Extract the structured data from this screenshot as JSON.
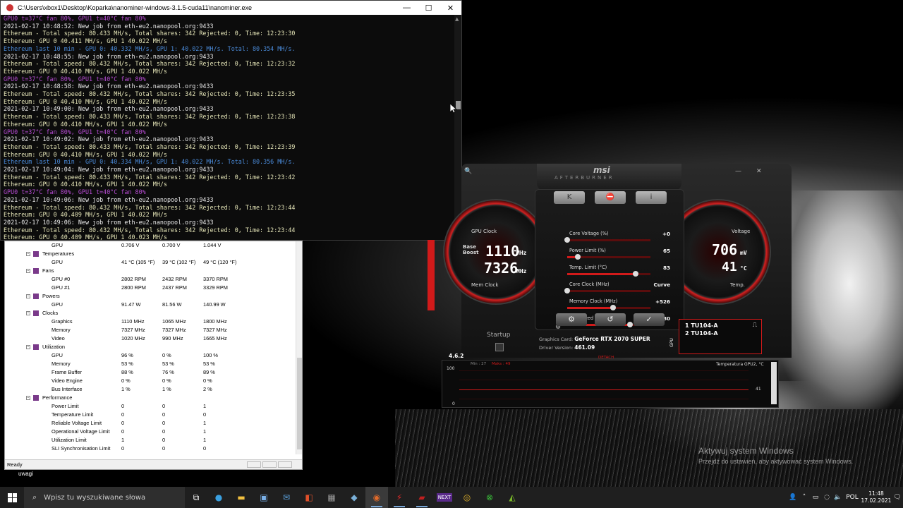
{
  "console": {
    "title": "C:\\Users\\xbox1\\Desktop\\Koparka\\nanominer-windows-3.1.5-cuda11\\nanominer.exe",
    "min": "—",
    "max": "☐",
    "close": "✕",
    "lines": [
      {
        "t": "GPU0 t=37°C fan 80%, GPU1 t=40°C fan 80%",
        "c": "p"
      },
      {
        "t": "2021-02-17 10:48:52: New job from eth-eu2.nanopool.org:9433",
        "c": "w"
      },
      {
        "t": "Ethereum - Total speed: 80.433 MH/s, Total shares: 342 Rejected: 0, Time: 12:23:30",
        "c": "y"
      },
      {
        "t": "Ethereum: GPU 0 40.411 MH/s, GPU 1 40.022 MH/s",
        "c": "y"
      },
      {
        "t": "Ethereum last 10 min - GPU 0: 40.332 MH/s, GPU 1: 40.022 MH/s. Total: 80.354 MH/s.",
        "c": "b"
      },
      {
        "t": "2021-02-17 10:48:55: New job from eth-eu2.nanopool.org:9433",
        "c": "w"
      },
      {
        "t": "Ethereum - Total speed: 80.432 MH/s, Total shares: 342 Rejected: 0, Time: 12:23:32",
        "c": "y"
      },
      {
        "t": "Ethereum: GPU 0 40.410 MH/s, GPU 1 40.022 MH/s",
        "c": "y"
      },
      {
        "t": "GPU0 t=37°C fan 80%, GPU1 t=40°C fan 80%",
        "c": "p"
      },
      {
        "t": "2021-02-17 10:48:58: New job from eth-eu2.nanopool.org:9433",
        "c": "w"
      },
      {
        "t": "Ethereum - Total speed: 80.432 MH/s, Total shares: 342 Rejected: 0, Time: 12:23:35",
        "c": "y"
      },
      {
        "t": "Ethereum: GPU 0 40.410 MH/s, GPU 1 40.022 MH/s",
        "c": "y"
      },
      {
        "t": "2021-02-17 10:49:00: New job from eth-eu2.nanopool.org:9433",
        "c": "w"
      },
      {
        "t": "Ethereum - Total speed: 80.433 MH/s, Total shares: 342 Rejected: 0, Time: 12:23:38",
        "c": "y"
      },
      {
        "t": "Ethereum: GPU 0 40.410 MH/s, GPU 1 40.022 MH/s",
        "c": "y"
      },
      {
        "t": "GPU0 t=37°C fan 80%, GPU1 t=40°C fan 80%",
        "c": "p"
      },
      {
        "t": "2021-02-17 10:49:02: New job from eth-eu2.nanopool.org:9433",
        "c": "w"
      },
      {
        "t": "Ethereum - Total speed: 80.433 MH/s, Total shares: 342 Rejected: 0, Time: 12:23:39",
        "c": "y"
      },
      {
        "t": "Ethereum: GPU 0 40.410 MH/s, GPU 1 40.022 MH/s",
        "c": "y"
      },
      {
        "t": "Ethereum last 10 min - GPU 0: 40.334 MH/s, GPU 1: 40.022 MH/s. Total: 80.356 MH/s.",
        "c": "b"
      },
      {
        "t": "2021-02-17 10:49:04: New job from eth-eu2.nanopool.org:9433",
        "c": "w"
      },
      {
        "t": "Ethereum - Total speed: 80.433 MH/s, Total shares: 342 Rejected: 0, Time: 12:23:42",
        "c": "y"
      },
      {
        "t": "Ethereum: GPU 0 40.410 MH/s, GPU 1 40.022 MH/s",
        "c": "y"
      },
      {
        "t": "GPU0 t=37°C fan 80%, GPU1 t=40°C fan 80%",
        "c": "p"
      },
      {
        "t": "2021-02-17 10:49:06: New job from eth-eu2.nanopool.org:9433",
        "c": "w"
      },
      {
        "t": "Ethereum - Total speed: 80.432 MH/s, Total shares: 342 Rejected: 0, Time: 12:23:44",
        "c": "y"
      },
      {
        "t": "Ethereum: GPU 0 40.409 MH/s, GPU 1 40.022 MH/s",
        "c": "y"
      },
      {
        "t": "2021-02-17 10:49:06: New job from eth-eu2.nanopool.org:9433",
        "c": "w"
      },
      {
        "t": "Ethereum - Total speed: 80.432 MH/s, Total shares: 342 Rejected: 0, Time: 12:23:44",
        "c": "y"
      },
      {
        "t": "Ethereum: GPU 0 40.409 MH/s, GPU 1 40.023 MH/s",
        "c": "y"
      }
    ]
  },
  "hwmonitor": {
    "rows": [
      {
        "name": "GPU",
        "indent": 4,
        "v1": "0.706 V",
        "v2": "0.700 V",
        "v3": "1.044 V"
      },
      {
        "name": "Temperatures",
        "indent": 3,
        "group": true,
        "v1": "",
        "v2": "",
        "v3": ""
      },
      {
        "name": "GPU",
        "indent": 4,
        "v1": "41 °C  (105 °F)",
        "v2": "39 °C  (102 °F)",
        "v3": "49 °C  (120 °F)"
      },
      {
        "name": "Fans",
        "indent": 3,
        "group": true,
        "v1": "",
        "v2": "",
        "v3": ""
      },
      {
        "name": "GPU #0",
        "indent": 4,
        "v1": "2802 RPM",
        "v2": "2432 RPM",
        "v3": "3370 RPM"
      },
      {
        "name": "GPU #1",
        "indent": 4,
        "v1": "2800 RPM",
        "v2": "2437 RPM",
        "v3": "3329 RPM"
      },
      {
        "name": "Powers",
        "indent": 3,
        "group": true,
        "v1": "",
        "v2": "",
        "v3": ""
      },
      {
        "name": "GPU",
        "indent": 4,
        "v1": "91.47 W",
        "v2": "81.56 W",
        "v3": "140.99 W"
      },
      {
        "name": "Clocks",
        "indent": 3,
        "group": true,
        "v1": "",
        "v2": "",
        "v3": ""
      },
      {
        "name": "Graphics",
        "indent": 4,
        "v1": "1110 MHz",
        "v2": "1065 MHz",
        "v3": "1800 MHz"
      },
      {
        "name": "Memory",
        "indent": 4,
        "v1": "7327 MHz",
        "v2": "7327 MHz",
        "v3": "7327 MHz"
      },
      {
        "name": "Video",
        "indent": 4,
        "v1": "1020 MHz",
        "v2": "990 MHz",
        "v3": "1665 MHz"
      },
      {
        "name": "Utilization",
        "indent": 3,
        "group": true,
        "v1": "",
        "v2": "",
        "v3": ""
      },
      {
        "name": "GPU",
        "indent": 4,
        "v1": "96 %",
        "v2": "0 %",
        "v3": "100 %"
      },
      {
        "name": "Memory",
        "indent": 4,
        "v1": "53 %",
        "v2": "53 %",
        "v3": "53 %"
      },
      {
        "name": "Frame Buffer",
        "indent": 4,
        "v1": "88 %",
        "v2": "76 %",
        "v3": "89 %"
      },
      {
        "name": "Video Engine",
        "indent": 4,
        "v1": "0 %",
        "v2": "0 %",
        "v3": "0 %"
      },
      {
        "name": "Bus Interface",
        "indent": 4,
        "v1": "1 %",
        "v2": "1 %",
        "v3": "2 %"
      },
      {
        "name": "Performance",
        "indent": 3,
        "group": true,
        "v1": "",
        "v2": "",
        "v3": ""
      },
      {
        "name": "Power Limit",
        "indent": 4,
        "v1": "0",
        "v2": "0",
        "v3": "1"
      },
      {
        "name": "Temperature Limit",
        "indent": 4,
        "v1": "0",
        "v2": "0",
        "v3": "0"
      },
      {
        "name": "Reliable Voltage Limit",
        "indent": 4,
        "v1": "0",
        "v2": "0",
        "v3": "1"
      },
      {
        "name": "Operational Voltage Limit",
        "indent": 4,
        "v1": "0",
        "v2": "0",
        "v3": "1"
      },
      {
        "name": "Utilization Limit",
        "indent": 4,
        "v1": "1",
        "v2": "0",
        "v3": "1"
      },
      {
        "name": "SLI Synchronisation Limit",
        "indent": 4,
        "v1": "0",
        "v2": "0",
        "v3": "0"
      }
    ],
    "status": "Ready",
    "below": "uwagi"
  },
  "afterburner": {
    "logo": "msi",
    "sublogo": "AFTERBURNER",
    "left_gauge": {
      "label_top": "GPU Clock",
      "label_bot": "Mem Clock",
      "base": "Base",
      "boost": "Boost",
      "clock": "1110",
      "clock_unit": "MHz",
      "mem": "7326",
      "mem_unit": "MHz"
    },
    "right_gauge": {
      "label": "Voltage",
      "volt": "706",
      "volt_unit": "mV",
      "temp": "41",
      "temp_unit": "°C",
      "temp_label": "Temp."
    },
    "sliders": [
      {
        "label": "Core Voltage (%)",
        "value": "+0",
        "fill": 0.0
      },
      {
        "label": "Power Limit (%)",
        "value": "65",
        "fill": 0.13
      },
      {
        "label": "Temp. Limit (°C)",
        "value": "83",
        "fill": 0.82
      },
      {
        "label": "Core Clock (MHz)",
        "value": "Curve",
        "fill": 0.0
      },
      {
        "label": "Memory Clock (MHz)",
        "value": "+526",
        "fill": 0.55
      },
      {
        "label": "Fan Speed (%)",
        "value": "80",
        "fill": 0.75
      }
    ],
    "startup": "Startup",
    "version": "4.6.2",
    "graphics_card_label": "Graphics Card:",
    "graphics_card": "GeForce RTX 2070 SUPER",
    "driver_label": "Driver Version:",
    "driver": "461.09",
    "detach": "DETACH",
    "gpu_list": [
      "1  TU104-A",
      "2  TU104-A"
    ],
    "graph": {
      "min_label": "Min : 27",
      "max_label": "Maks : 49",
      "title": "Temperatura GPU2, °C",
      "y_top": "100",
      "y_bottom": "0",
      "current": "41"
    }
  },
  "desktop": {
    "watermark": "Aktywuj system Windows",
    "watermark_sub": "Przejdź do ustawień, aby aktywować system Windows."
  },
  "taskbar": {
    "search_placeholder": "Wpisz tu wyszukiwane słowa",
    "lang": "POL",
    "time": "11:48",
    "date": "17.02.2021"
  }
}
